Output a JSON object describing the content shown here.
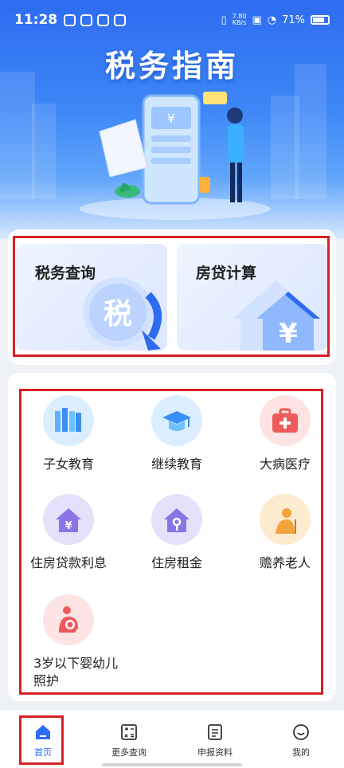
{
  "status_bar": {
    "time": "11:28",
    "net_speed_value": "7.80",
    "net_speed_unit": "KB/s",
    "battery": "71%"
  },
  "hero": {
    "title": "税务指南",
    "phone_symbol": "¥"
  },
  "quick_actions": [
    {
      "label": "税务查询",
      "icon": "tax-magnifier-icon",
      "glyph": "税"
    },
    {
      "label": "房贷计算",
      "icon": "house-yuan-icon",
      "glyph": "¥"
    }
  ],
  "deductions": [
    {
      "label": "子女教育",
      "icon": "books-icon",
      "color": "#dbeeff"
    },
    {
      "label": "继续教育",
      "icon": "graduation-cap-icon",
      "color": "#dbeeff"
    },
    {
      "label": "大病医疗",
      "icon": "medical-kit-icon",
      "color": "#fde3e3"
    },
    {
      "label": "住房贷款利息",
      "icon": "house-yuan-icon",
      "color": "#e6e1fb"
    },
    {
      "label": "住房租金",
      "icon": "house-key-icon",
      "color": "#e6e1fb"
    },
    {
      "label": "赡养老人",
      "icon": "elderly-icon",
      "color": "#fdebcf"
    },
    {
      "label": "3岁以下婴幼儿照护",
      "icon": "infant-care-icon",
      "color": "#fde3e3"
    }
  ],
  "bottom_nav": [
    {
      "label": "首页",
      "icon": "home-icon",
      "active": true
    },
    {
      "label": "更多查询",
      "icon": "calculator-icon",
      "active": false
    },
    {
      "label": "申报资料",
      "icon": "document-icon",
      "active": false
    },
    {
      "label": "我的",
      "icon": "smile-icon",
      "active": false
    }
  ],
  "colors": {
    "accent": "#2d6cf3",
    "highlight_border": "#d81f26"
  }
}
